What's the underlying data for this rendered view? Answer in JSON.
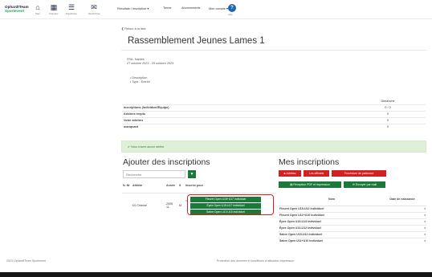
{
  "brand": {
    "line1": "OphardtTeam",
    "line2": "Sportevent"
  },
  "nav_icons": [
    {
      "icon": "home-icon",
      "glyph": "⌂",
      "caption": "Start"
    },
    {
      "icon": "calendar-icon",
      "glyph": "▦",
      "caption": "Kalender"
    },
    {
      "icon": "list-icon",
      "glyph": "☰",
      "caption": "Ergebnisse"
    },
    {
      "icon": "mail-icon",
      "glyph": "✉",
      "caption": "Nachrichten"
    }
  ],
  "menu": [
    "Résultats / Inscription ▾",
    "Terme",
    "Abonnements",
    "Mon compte ▾"
  ],
  "help": {
    "glyph": "?",
    "caption": "Aide"
  },
  "back_link": "❮ Retour à la liste",
  "event_title": "Rassemblement Jeunes Lames 1",
  "info_lines": [
    "FRA, Nantes",
    "27 octobre 2023 - 29 octobre 2023"
  ],
  "bullets": [
    "• Description",
    "• Type : Entrée"
  ],
  "stats": {
    "column_header": "Dimanche",
    "rows": [
      {
        "label": "Inscriptions (Individuel/Équipe)",
        "value": "0 / 0"
      },
      {
        "label": "Arbitres requis",
        "value": "0"
      },
      {
        "label": "Votre arbitres",
        "value": "0"
      },
      {
        "label": "manquant",
        "value": "0"
      }
    ]
  },
  "alert_text": "✔ Vous n'avez aucun arbitre.",
  "add_section": {
    "title": "Ajouter des inscriptions",
    "search_placeholder": "Recherche",
    "search_glyph": "▼",
    "columns": [
      "N. Nt",
      "Athlète",
      "Année",
      "S",
      "Inscrire pour"
    ],
    "row": {
      "num": "",
      "name": "DL Chleme",
      "year": "2005",
      "year2": "11",
      "sex": "M",
      "eq": "=",
      "buttons": [
        "Fleuret Open U15+U17 Individuel",
        "Épée Open U15-U17 Individuel",
        "Sabre Open U13 U15 Individuel"
      ]
    }
  },
  "mine_section": {
    "title": "Mes inscriptions",
    "red_buttons": [
      "♣ Arbitres",
      "Les officiels",
      "Procédure de paiement"
    ],
    "green_buttons": [
      "▤ Réception PDF et impression",
      "✉ Envoyer par mail"
    ],
    "columns": [
      "Nom",
      "Date de naissance"
    ],
    "rows": [
      "Fleuret Open U15-U12 Individuel",
      "Fleuret Open U11+U10 Individuel",
      "Épée Open U15-U13 Individuel",
      "Épée Open U13-U12 Individuel",
      "Sabre Open U15-U12 Individuel",
      "Sabre Open U11+U10 Individuel"
    ],
    "row_action": "x"
  },
  "footer": {
    "left": "2023 OphardtTeam Sportevent",
    "right": "Protection des données et conditions d'utilisation    Impressum"
  },
  "colors": {
    "green": "#1b7a3a",
    "red": "#d32121",
    "navy": "#16233f",
    "alert": "#dff0d8"
  }
}
